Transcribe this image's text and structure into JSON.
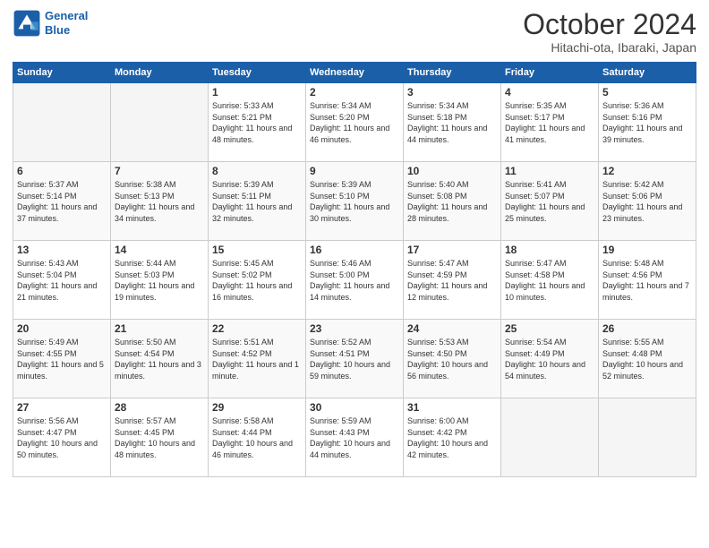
{
  "header": {
    "logo_line1": "General",
    "logo_line2": "Blue",
    "month_title": "October 2024",
    "location": "Hitachi-ota, Ibaraki, Japan"
  },
  "weekdays": [
    "Sunday",
    "Monday",
    "Tuesday",
    "Wednesday",
    "Thursday",
    "Friday",
    "Saturday"
  ],
  "weeks": [
    [
      {
        "day": "",
        "empty": true
      },
      {
        "day": "",
        "empty": true
      },
      {
        "day": "1",
        "sunrise": "Sunrise: 5:33 AM",
        "sunset": "Sunset: 5:21 PM",
        "daylight": "Daylight: 11 hours and 48 minutes."
      },
      {
        "day": "2",
        "sunrise": "Sunrise: 5:34 AM",
        "sunset": "Sunset: 5:20 PM",
        "daylight": "Daylight: 11 hours and 46 minutes."
      },
      {
        "day": "3",
        "sunrise": "Sunrise: 5:34 AM",
        "sunset": "Sunset: 5:18 PM",
        "daylight": "Daylight: 11 hours and 44 minutes."
      },
      {
        "day": "4",
        "sunrise": "Sunrise: 5:35 AM",
        "sunset": "Sunset: 5:17 PM",
        "daylight": "Daylight: 11 hours and 41 minutes."
      },
      {
        "day": "5",
        "sunrise": "Sunrise: 5:36 AM",
        "sunset": "Sunset: 5:16 PM",
        "daylight": "Daylight: 11 hours and 39 minutes."
      }
    ],
    [
      {
        "day": "6",
        "sunrise": "Sunrise: 5:37 AM",
        "sunset": "Sunset: 5:14 PM",
        "daylight": "Daylight: 11 hours and 37 minutes."
      },
      {
        "day": "7",
        "sunrise": "Sunrise: 5:38 AM",
        "sunset": "Sunset: 5:13 PM",
        "daylight": "Daylight: 11 hours and 34 minutes."
      },
      {
        "day": "8",
        "sunrise": "Sunrise: 5:39 AM",
        "sunset": "Sunset: 5:11 PM",
        "daylight": "Daylight: 11 hours and 32 minutes."
      },
      {
        "day": "9",
        "sunrise": "Sunrise: 5:39 AM",
        "sunset": "Sunset: 5:10 PM",
        "daylight": "Daylight: 11 hours and 30 minutes."
      },
      {
        "day": "10",
        "sunrise": "Sunrise: 5:40 AM",
        "sunset": "Sunset: 5:08 PM",
        "daylight": "Daylight: 11 hours and 28 minutes."
      },
      {
        "day": "11",
        "sunrise": "Sunrise: 5:41 AM",
        "sunset": "Sunset: 5:07 PM",
        "daylight": "Daylight: 11 hours and 25 minutes."
      },
      {
        "day": "12",
        "sunrise": "Sunrise: 5:42 AM",
        "sunset": "Sunset: 5:06 PM",
        "daylight": "Daylight: 11 hours and 23 minutes."
      }
    ],
    [
      {
        "day": "13",
        "sunrise": "Sunrise: 5:43 AM",
        "sunset": "Sunset: 5:04 PM",
        "daylight": "Daylight: 11 hours and 21 minutes."
      },
      {
        "day": "14",
        "sunrise": "Sunrise: 5:44 AM",
        "sunset": "Sunset: 5:03 PM",
        "daylight": "Daylight: 11 hours and 19 minutes."
      },
      {
        "day": "15",
        "sunrise": "Sunrise: 5:45 AM",
        "sunset": "Sunset: 5:02 PM",
        "daylight": "Daylight: 11 hours and 16 minutes."
      },
      {
        "day": "16",
        "sunrise": "Sunrise: 5:46 AM",
        "sunset": "Sunset: 5:00 PM",
        "daylight": "Daylight: 11 hours and 14 minutes."
      },
      {
        "day": "17",
        "sunrise": "Sunrise: 5:47 AM",
        "sunset": "Sunset: 4:59 PM",
        "daylight": "Daylight: 11 hours and 12 minutes."
      },
      {
        "day": "18",
        "sunrise": "Sunrise: 5:47 AM",
        "sunset": "Sunset: 4:58 PM",
        "daylight": "Daylight: 11 hours and 10 minutes."
      },
      {
        "day": "19",
        "sunrise": "Sunrise: 5:48 AM",
        "sunset": "Sunset: 4:56 PM",
        "daylight": "Daylight: 11 hours and 7 minutes."
      }
    ],
    [
      {
        "day": "20",
        "sunrise": "Sunrise: 5:49 AM",
        "sunset": "Sunset: 4:55 PM",
        "daylight": "Daylight: 11 hours and 5 minutes."
      },
      {
        "day": "21",
        "sunrise": "Sunrise: 5:50 AM",
        "sunset": "Sunset: 4:54 PM",
        "daylight": "Daylight: 11 hours and 3 minutes."
      },
      {
        "day": "22",
        "sunrise": "Sunrise: 5:51 AM",
        "sunset": "Sunset: 4:52 PM",
        "daylight": "Daylight: 11 hours and 1 minute."
      },
      {
        "day": "23",
        "sunrise": "Sunrise: 5:52 AM",
        "sunset": "Sunset: 4:51 PM",
        "daylight": "Daylight: 10 hours and 59 minutes."
      },
      {
        "day": "24",
        "sunrise": "Sunrise: 5:53 AM",
        "sunset": "Sunset: 4:50 PM",
        "daylight": "Daylight: 10 hours and 56 minutes."
      },
      {
        "day": "25",
        "sunrise": "Sunrise: 5:54 AM",
        "sunset": "Sunset: 4:49 PM",
        "daylight": "Daylight: 10 hours and 54 minutes."
      },
      {
        "day": "26",
        "sunrise": "Sunrise: 5:55 AM",
        "sunset": "Sunset: 4:48 PM",
        "daylight": "Daylight: 10 hours and 52 minutes."
      }
    ],
    [
      {
        "day": "27",
        "sunrise": "Sunrise: 5:56 AM",
        "sunset": "Sunset: 4:47 PM",
        "daylight": "Daylight: 10 hours and 50 minutes."
      },
      {
        "day": "28",
        "sunrise": "Sunrise: 5:57 AM",
        "sunset": "Sunset: 4:45 PM",
        "daylight": "Daylight: 10 hours and 48 minutes."
      },
      {
        "day": "29",
        "sunrise": "Sunrise: 5:58 AM",
        "sunset": "Sunset: 4:44 PM",
        "daylight": "Daylight: 10 hours and 46 minutes."
      },
      {
        "day": "30",
        "sunrise": "Sunrise: 5:59 AM",
        "sunset": "Sunset: 4:43 PM",
        "daylight": "Daylight: 10 hours and 44 minutes."
      },
      {
        "day": "31",
        "sunrise": "Sunrise: 6:00 AM",
        "sunset": "Sunset: 4:42 PM",
        "daylight": "Daylight: 10 hours and 42 minutes."
      },
      {
        "day": "",
        "empty": true
      },
      {
        "day": "",
        "empty": true
      }
    ]
  ]
}
